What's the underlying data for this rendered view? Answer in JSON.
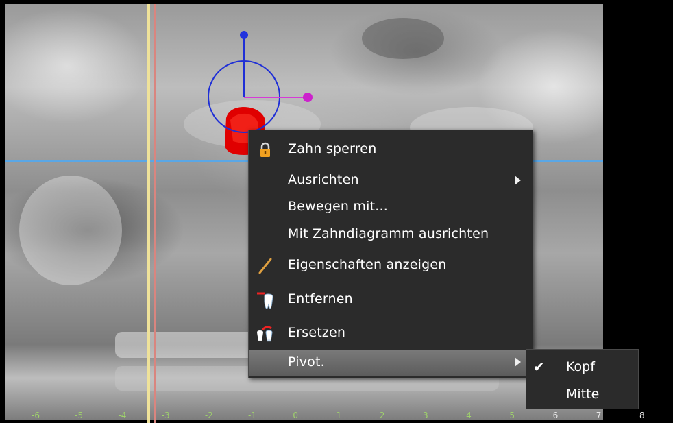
{
  "viewer": {
    "ruler_ticks": [
      "-6",
      "-5",
      "-4",
      "-3",
      "-2",
      "-1",
      "0",
      "1",
      "2",
      "3",
      "4",
      "5",
      "6",
      "7",
      "8"
    ]
  },
  "context_menu": {
    "items": [
      {
        "label": "Zahn sperren",
        "icon": "lock-icon",
        "has_submenu": false
      },
      {
        "label": "Ausrichten",
        "icon": "",
        "has_submenu": true
      },
      {
        "label": "Bewegen mit...",
        "icon": "",
        "has_submenu": false
      },
      {
        "label": "Mit Zahndiagramm ausrichten",
        "icon": "",
        "has_submenu": false
      },
      {
        "label": "Eigenschaften anzeigen",
        "icon": "pencil-icon",
        "has_submenu": false
      },
      {
        "label": "Entfernen",
        "icon": "tooth-remove-icon",
        "has_submenu": false
      },
      {
        "label": "Ersetzen",
        "icon": "tooth-replace-icon",
        "has_submenu": false
      },
      {
        "label": "Pivot.",
        "icon": "",
        "has_submenu": true,
        "highlighted": true
      }
    ]
  },
  "pivot_submenu": {
    "items": [
      {
        "label": "Kopf",
        "checked": true
      },
      {
        "label": "Mitte",
        "checked": false
      }
    ]
  },
  "colors": {
    "crosshair_horizontal": "#5aa7e6",
    "crosshair_yellow": "#efe29a",
    "crosshair_red": "#d9857f",
    "gizmo_blue": "#1f2fd6",
    "gizmo_magenta": "#d63bd6",
    "tooth_red": "#e00000"
  }
}
